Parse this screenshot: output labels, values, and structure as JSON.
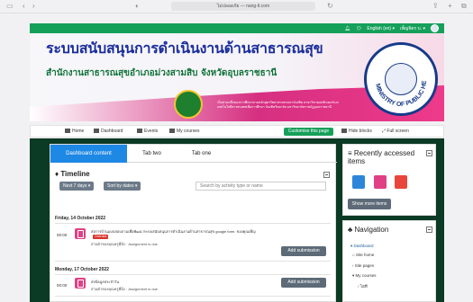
{
  "browser": {
    "address": "ไม่ปลอดภัย — nang-lt.com"
  },
  "navbar": {
    "language": "English (en) ▾",
    "username": "เพ็ญจิตร บ. ▾"
  },
  "banner": {
    "title": "ระบบสนับสนุนการดำเนินงานด้านสาธารณสุข",
    "subtitle": "สำนักงานสาธารณสุขอำเภอม่วงสามสิบ จังหวัดอุบลราชธานี",
    "small_text": "เป็นส่วนหนึ่งของการศึกษาตามหลักสูตรวิทยาศาสตรมหาบัณฑิต สาขาวิชาคอมพิวเตอร์และเทคโนโลยีสารสนเทศเพื่อการศึกษา บัณฑิตวิทยาลัย มหาวิทยาลัยราชภัฏอุบลราชธานี",
    "seal_text": "MINISTRY OF PUBLIC HEALTH"
  },
  "menu": {
    "home": "Home",
    "dashboard": "Dashboard",
    "events": "Events",
    "my_courses": "My courses",
    "customise": "Customise this page",
    "hide_blocks": "Hide blocks",
    "full_screen": "Full screen"
  },
  "tabs": [
    "Dashboard content",
    "Tab two",
    "Tab one"
  ],
  "timeline": {
    "title": "Timeline",
    "filter": "Next 7 days ▾",
    "sort": "Sort by dates ▾",
    "search_placeholder": "Search by activity type or name",
    "groups": [
      {
        "date": "Friday, 14 October 2022",
        "events": [
          {
            "time": "00:00",
            "title": "ส่งการบ้านแบบสอบถามเพื่อพัฒนาระบบสนับสนุนการดำเนินงานด้านสาธารณสุข google form. ของคุณเพ็ญ",
            "badge": "Overdue",
            "course": "ส่วนตัวของคุณครูพี่มิ่ง · Assignment is due",
            "button": "Add submission"
          }
        ]
      },
      {
        "date": "Monday, 17 October 2022",
        "events": [
          {
            "time": "00:00",
            "title": "ส่งข้อมูลประจำวัน",
            "badge": "",
            "course": "ส่วนตัวของคุณครูพี่มิ่ง · Assignment is due",
            "button": "Add submission"
          }
        ]
      }
    ]
  },
  "recent": {
    "title": "Recently accessed items",
    "more": "Show more items",
    "colors": [
      "#2b86d9",
      "#e04085",
      "#e9463b"
    ]
  },
  "navigation": {
    "title": "Navigation",
    "items": [
      "Dashboard",
      "Site home",
      "Site pages",
      "My courses",
      "ไอที"
    ]
  },
  "colors": {
    "navbar": "#15a05a",
    "page_bg": "#0b3a25",
    "tab_active": "#1e88e5"
  }
}
